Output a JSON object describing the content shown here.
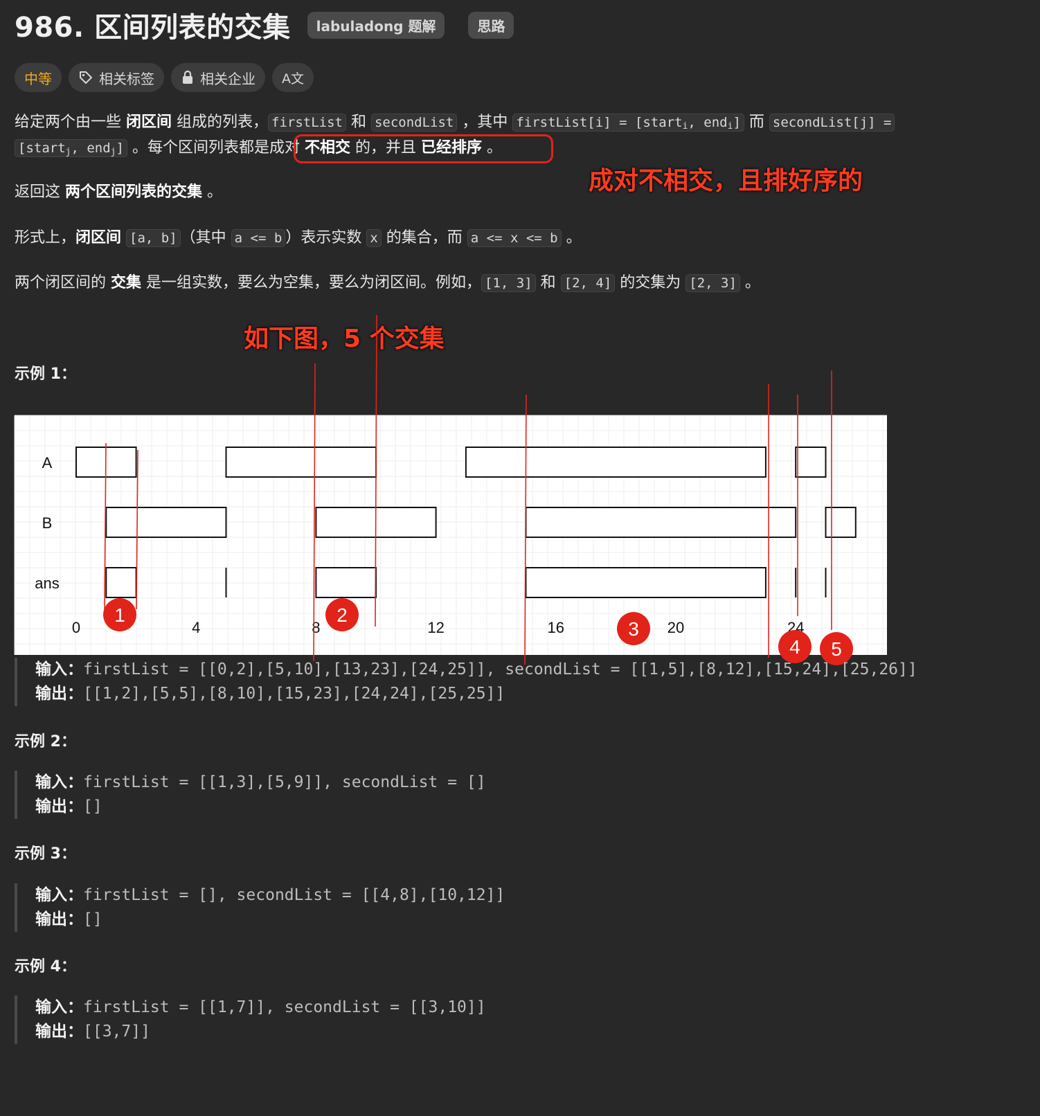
{
  "problem": {
    "title": "986. 区间列表的交集",
    "badges": [
      "labuladong 题解",
      "思路"
    ]
  },
  "tags": {
    "difficulty": "中等",
    "related_tags": "相关标签",
    "related_companies": "相关企业",
    "translate": "A文"
  },
  "description": {
    "p1": {
      "t1": "给定两个由一些 ",
      "b1": "闭区间",
      "t2": " 组成的列表，",
      "c1": "firstList",
      "t3": " 和 ",
      "c2": "secondList",
      "t4": " ，其中 ",
      "c3_pre": "firstList[i] = [start",
      "c3_sub1": "i",
      "c3_mid": ", end",
      "c3_sub2": "i",
      "c3_post": "]",
      "t5": " 而 ",
      "c4": "secondList[j] =",
      "c5_pre": "[start",
      "c5_sub1": "j",
      "c5_mid": ", end",
      "c5_sub2": "j",
      "c5_post": "]",
      "t6": " 。每个区间列表都是",
      "t7": "成对 ",
      "b2": "不相交",
      "t8": " 的，并且 ",
      "b3": "已经排序",
      "t9": " 。"
    },
    "p2": {
      "t1": "返回这 ",
      "b1": "两个区间列表的交集",
      "t2": " 。"
    },
    "p3": {
      "t1": "形式上，",
      "b1": "闭区间",
      "c1": "[a, b]",
      "t2": "（其中 ",
      "c2": "a <= b",
      "t3": "）表示实数 ",
      "c3": "x",
      "t4": " 的集合，而 ",
      "c4": "a <= x <= b",
      "t5": " 。"
    },
    "p4": {
      "t1": "两个闭区间的 ",
      "b1": "交集",
      "t2": " 是一组实数，要么为空集，要么为闭区间。例如，",
      "c1": "[1, 3]",
      "t3": " 和 ",
      "c2": "[2, 4]",
      "t4": " 的交集为 ",
      "c3": "[2, 3]",
      "t5": " 。"
    }
  },
  "annotations": {
    "note1": "成对不相交，且排好序的",
    "note2": "如下图，5 个交集",
    "markers": [
      "1",
      "2",
      "3",
      "4",
      "5"
    ]
  },
  "diagram": {
    "row_labels": [
      "A",
      "B",
      "ans"
    ],
    "axis_ticks": [
      "0",
      "4",
      "8",
      "12",
      "16",
      "20",
      "24"
    ],
    "A": [
      [
        0,
        2
      ],
      [
        5,
        10
      ],
      [
        13,
        23
      ],
      [
        24,
        25
      ]
    ],
    "B": [
      [
        1,
        5
      ],
      [
        8,
        12
      ],
      [
        15,
        24
      ],
      [
        25,
        26
      ]
    ],
    "ans": [
      [
        1,
        2
      ],
      [
        5,
        5
      ],
      [
        8,
        10
      ],
      [
        15,
        23
      ],
      [
        24,
        24
      ],
      [
        25,
        25
      ]
    ]
  },
  "examples": [
    {
      "heading": "示例 1：",
      "input_label": "输入：",
      "input": "firstList = [[0,2],[5,10],[13,23],[24,25]], secondList = [[1,5],[8,12],[15,24],[25,26]]",
      "output_label": "输出：",
      "output": "[[1,2],[5,5],[8,10],[15,23],[24,24],[25,25]]"
    },
    {
      "heading": "示例 2：",
      "input_label": "输入：",
      "input": "firstList = [[1,3],[5,9]], secondList = []",
      "output_label": "输出：",
      "output": "[]"
    },
    {
      "heading": "示例 3：",
      "input_label": "输入：",
      "input": "firstList = [], secondList = [[4,8],[10,12]]",
      "output_label": "输出：",
      "output": "[]"
    },
    {
      "heading": "示例 4：",
      "input_label": "输入：",
      "input": "firstList = [[1,7]], secondList = [[3,10]]",
      "output_label": "输出：",
      "output": "[[3,7]]"
    }
  ],
  "colors": {
    "annotation_red": "#e2231a",
    "difficulty": "#f1a821",
    "background": "#282828"
  }
}
